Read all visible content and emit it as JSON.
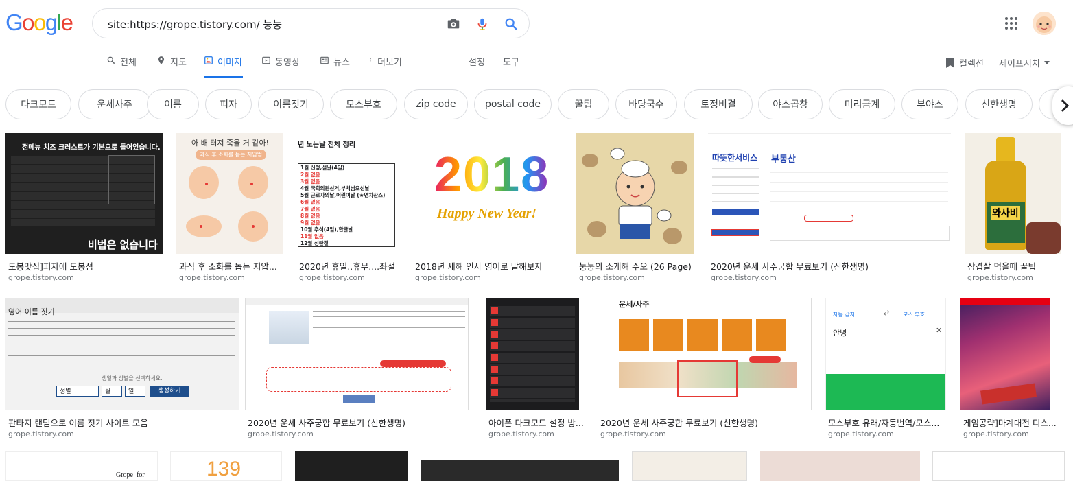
{
  "search": {
    "query": "site:https://grope.tistory.com/ 눙눙"
  },
  "tabs": [
    {
      "label": "전체",
      "icon": "search-icon"
    },
    {
      "label": "지도",
      "icon": "map-pin-icon"
    },
    {
      "label": "이미지",
      "icon": "image-icon",
      "active": true
    },
    {
      "label": "동영상",
      "icon": "video-icon"
    },
    {
      "label": "뉴스",
      "icon": "news-icon"
    },
    {
      "label": "더보기",
      "icon": "more-vert-icon"
    }
  ],
  "tools": {
    "settings": "설정",
    "tools": "도구",
    "collection": "컬렉션",
    "safesearch": "세이프서치"
  },
  "chips": [
    "다크모드",
    "운세사주",
    "이름",
    "피자",
    "이름짓기",
    "모스부호",
    "zip code",
    "postal code",
    "꿀팁",
    "바당국수",
    "토정비결",
    "야스곱창",
    "미리금계",
    "부야스",
    "신한생명"
  ],
  "results_row1": [
    {
      "title": "도봉맛집]피자애 도봉점",
      "domain": "grope.tistory.com"
    },
    {
      "title": "과식 후 소화를 돕는 지압...",
      "domain": "grope.tistory.com"
    },
    {
      "title": "2020년 휴일..휴무....좌절",
      "domain": "grope.tistory.com"
    },
    {
      "title": "2018년 새해 인사 영어로 말해보자",
      "domain": "grope.tistory.com"
    },
    {
      "title": "눙눙의 소개해 주오 (26 Page)",
      "domain": "grope.tistory.com"
    },
    {
      "title": "2020년 운세 사주궁합 무료보기 (신한생명)",
      "domain": "grope.tistory.com"
    },
    {
      "title": "삼겹살 먹을때 꿀팁",
      "domain": "grope.tistory.com"
    }
  ],
  "results_row2": [
    {
      "title": "판타지 랜덤으로 이름 짓기 사이트 모음",
      "domain": "grope.tistory.com"
    },
    {
      "title": "2020년 운세 사주궁합 무료보기 (신한생명)",
      "domain": "grope.tistory.com"
    },
    {
      "title": "아이폰 다크모드 설정 방...",
      "domain": "grope.tistory.com"
    },
    {
      "title": "2020년 운세 사주궁합 무료보기 (신한생명)",
      "domain": "grope.tistory.com"
    },
    {
      "title": "모스부호 유래/자동번역/모스...",
      "domain": "grope.tistory.com"
    },
    {
      "title": "게임공략]마계대전 디스...",
      "domain": "grope.tistory.com"
    }
  ],
  "thumb_text": {
    "pizza_header": "전메뉴 치즈 크러스트가 기본으로 들어있습니다.",
    "pizza_footer": "비법은 없습니다",
    "acupressure_title": "아 배 터져 죽을 거 같아!",
    "acupressure_sub": "과식 후 소화를 돕는 지압법",
    "holiday_title": "년 노는날 전체 정리",
    "holiday_lines": [
      "1월 신정,설날(4일)",
      "2월 없음",
      "3월 없음",
      "4월 국회의원선거,부처님오신날",
      "5월 근로자의날,어린이날 (★연차찬스)",
      "6월 없음",
      "7월 없음",
      "8월 없음",
      "9월 없음",
      "10월 추석(4일),한글날",
      "11월 없음",
      "12월 성탄절"
    ],
    "newyear_number": "2018",
    "newyear_text": "Happy New Year!",
    "shinhan_service": "따뜻한서비스",
    "shinhan_section": "부동산",
    "wasabi_label": "와사비",
    "name_title": "영어 이름 짓기",
    "name_button": "생성하기",
    "name_select1": "성별",
    "name_select2": "월",
    "name_select3": "일",
    "name_prompt": "생일과 성별을 선택하세요.",
    "fortune_title": "운세/사주",
    "morse_label": "안녕",
    "morse_src": "자동 감지",
    "morse_dst": "모스 부호",
    "temp_number": "139",
    "grope_label": "Grope_for"
  },
  "colors": {
    "accent": "#1a73e8",
    "text_secondary": "#5f6368",
    "domain": "#70757a"
  }
}
